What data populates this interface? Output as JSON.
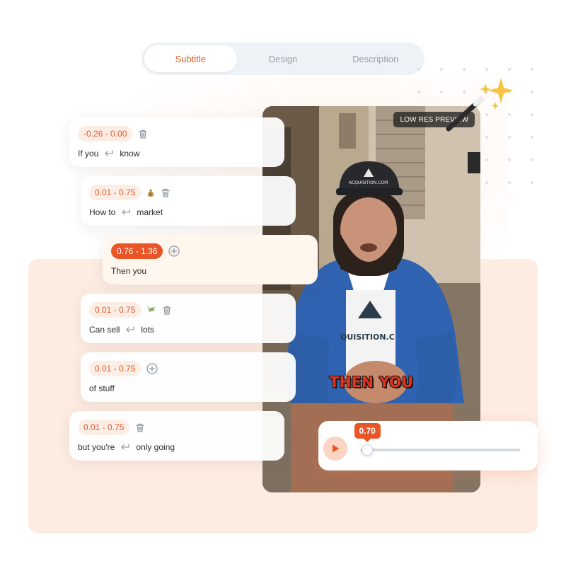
{
  "tabs": [
    {
      "label": "Subtitle",
      "active": true
    },
    {
      "label": "Design",
      "active": false
    },
    {
      "label": "Description",
      "active": false
    }
  ],
  "video": {
    "badge": "LOW RES PREVIEW",
    "caption": "THEN YOU",
    "cap_text": "ACQUISITION.COM",
    "shirt_text": "QUISITION.C"
  },
  "cards": [
    {
      "time": "-0.26 - 0.00",
      "words": [
        "If you",
        "know"
      ],
      "action": "trash-icon"
    },
    {
      "time": "0.01 - 0.75",
      "words": [
        "How to",
        "market"
      ],
      "action": "trash-icon",
      "emoji": "money-bag-icon"
    },
    {
      "time": "0.76 - 1.36",
      "words": [
        "Then you"
      ],
      "action": "plus-circle-icon",
      "active": true
    },
    {
      "time": "0.01 - 0.75",
      "words": [
        "Can sell",
        "lots"
      ],
      "action": "trash-icon",
      "emoji": "money-wings-icon"
    },
    {
      "time": "0.01 - 0.75",
      "words": [
        "of stuff"
      ],
      "action": "plus-circle-icon"
    },
    {
      "time": "0.01 - 0.75",
      "words": [
        "but you're",
        "only going"
      ],
      "action": "trash-icon"
    }
  ],
  "player": {
    "current_time": "0.70",
    "progress": 0.04
  },
  "colors": {
    "accent": "#e95527",
    "accent_soft": "#fdeee5",
    "background_blob": "#fdece2"
  }
}
